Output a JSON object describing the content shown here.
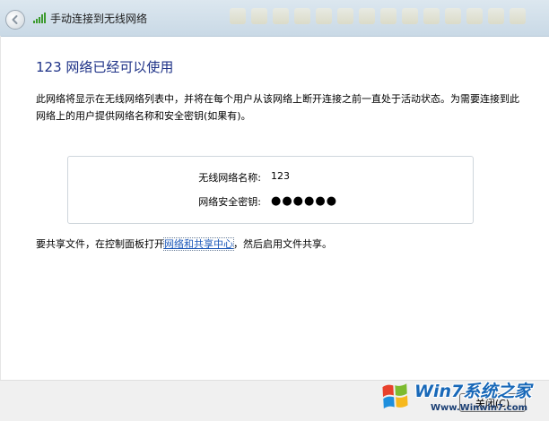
{
  "window": {
    "title": "手动连接到无线网络"
  },
  "main": {
    "heading": "123 网络已经可以使用",
    "description": "此网络将显示在无线网络列表中，并将在每个用户从该网络上断开连接之前一直处于活动状态。为需要连接到此网络上的用户提供网络名称和安全密钥(如果有)。",
    "info": {
      "network_name_label": "无线网络名称:",
      "network_name_value": "123",
      "security_key_label": "网络安全密钥:",
      "security_key_value": "●●●●●●"
    },
    "share": {
      "prefix": "要共享文件，在控制面板打开",
      "link_text": "网络和共享中心",
      "suffix": "，然后启用文件共享。"
    }
  },
  "footer": {
    "close_label": "关闭(C)"
  },
  "watermark": {
    "title": "Win7系统之家",
    "url": "Www.Winwin7.com"
  },
  "icons": {
    "back": "back-arrow-icon",
    "signal": "wireless-signal-icon",
    "watermark_logo": "windows-logo-icon"
  },
  "colors": {
    "heading": "#1e3287",
    "link": "#1b57b8",
    "watermark": "#1868b8"
  }
}
